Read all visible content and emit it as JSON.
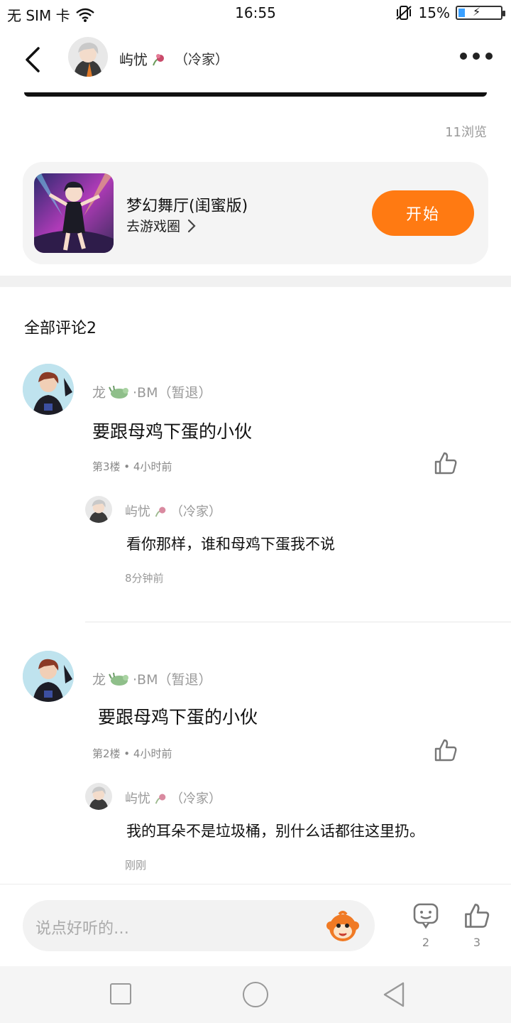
{
  "status_bar": {
    "carrier": "无 SIM 卡",
    "time": "16:55",
    "battery": "15%",
    "battery_level": 0.15
  },
  "header": {
    "author_name": "屿忧",
    "author_tag": "（冷家）"
  },
  "post": {
    "views": "11浏览"
  },
  "game_card": {
    "title": "梦幻舞厅(闺蜜版)",
    "sub_link": "去游戏圈",
    "start_label": "开始"
  },
  "comments_section": {
    "title": "全部评论2",
    "comments": [
      {
        "author": "龙",
        "author_suffix": "·BM（暂退）",
        "text": "要跟母鸡下蛋的小伙",
        "meta": "第3楼 • 4小时前",
        "reply": {
          "author": "屿忧",
          "author_tag": "（冷家）",
          "text": "看你那样，谁和母鸡下蛋我不说",
          "time": "8分钟前"
        }
      },
      {
        "author": "龙",
        "author_suffix": "·BM（暂退）",
        "text": " 要跟母鸡下蛋的小伙",
        "meta": "第2楼 • 4小时前",
        "reply": {
          "author": "屿忧",
          "author_tag": "（冷家）",
          "text": "我的耳朵不是垃圾桶，别什么话都往这里扔。",
          "time": "刚刚"
        }
      }
    ]
  },
  "bottom_bar": {
    "placeholder": "说点好听的…",
    "comment_count": "2",
    "like_count": "3"
  },
  "colors": {
    "accent_orange": "#ff7a12",
    "muted_text": "#999999",
    "card_bg": "#f4f4f4"
  }
}
